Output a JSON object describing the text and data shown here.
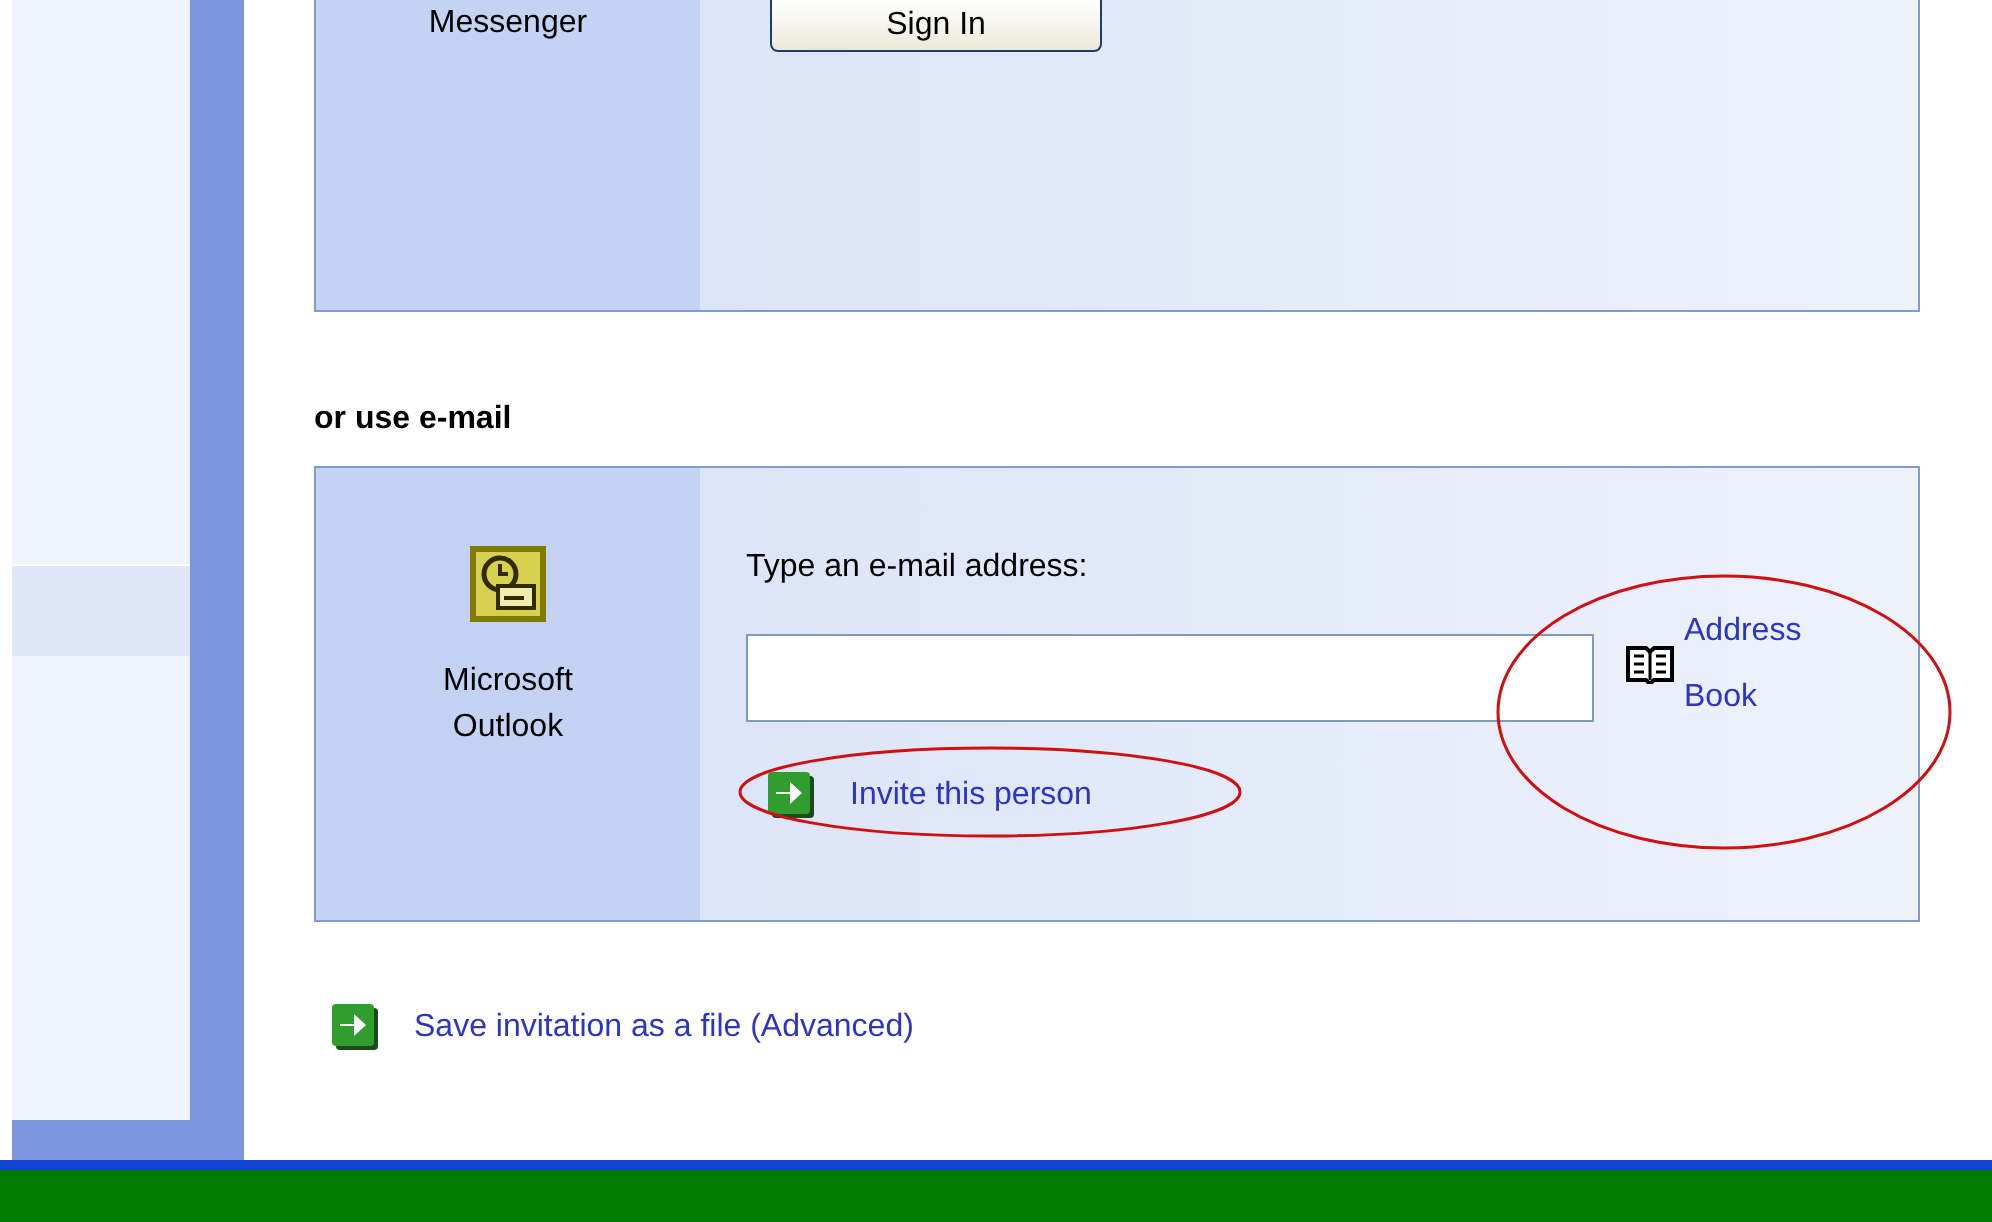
{
  "messenger": {
    "label": "Messenger",
    "button": "Sign In"
  },
  "email_heading": "or use e-mail",
  "email": {
    "app_label": "Microsoft Outlook",
    "field_label": "Type an e-mail address:",
    "address_book": "Address Book",
    "invite": "Invite this person"
  },
  "save_link": "Save invitation as a file (Advanced)"
}
